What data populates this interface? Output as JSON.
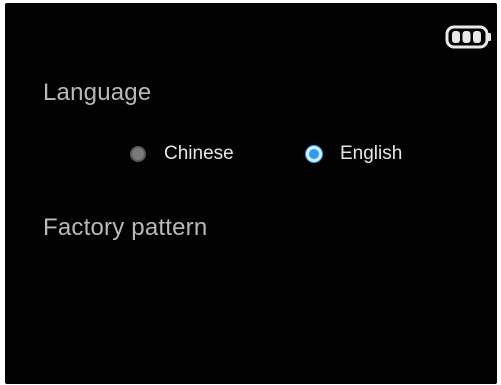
{
  "status_bar": {
    "battery_icon": "battery-full-icon",
    "battery_level": 1.0
  },
  "language_section": {
    "title": "Language",
    "options": [
      {
        "label": "Chinese",
        "selected": false
      },
      {
        "label": "English",
        "selected": true
      }
    ]
  },
  "factory_section": {
    "title": "Factory pattern"
  },
  "colors": {
    "background": "#020202",
    "accent": "#2d9cf0",
    "section_title": "#b9b9b9",
    "option_text": "#e6e6e6"
  }
}
